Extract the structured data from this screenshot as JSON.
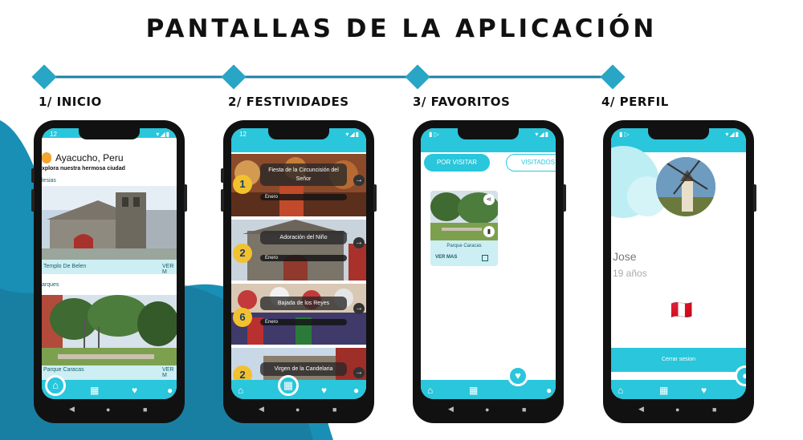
{
  "title": "PANTALLAS DE LA APLICACIÓN",
  "steps": [
    "1/ INICIO",
    "2/ FESTIVIDADES",
    "3/ FAVORITOS",
    "4/ PERFIL"
  ],
  "colors": {
    "accent": "#29c6dc",
    "dark": "#111111",
    "wave": "#1a8fb5",
    "timeline": "#1e7ea1"
  },
  "inicio": {
    "city": "Ayacucho, Peru",
    "subtitle": "xplora nuestra hermosa ciudad",
    "section1": "lesias",
    "place1": "Templo De Belen",
    "section2": "arques",
    "place2": "Parque Caracas",
    "ver": "VER M"
  },
  "festividades": {
    "items": [
      {
        "num": "1",
        "name": "Fiesta de la Circuncisión del Señor",
        "month": "Enero"
      },
      {
        "num": "2",
        "name": "Adoración del Niño",
        "month": "Enero"
      },
      {
        "num": "6",
        "name": "Bajada de los Reyes",
        "month": "Enero"
      },
      {
        "num": "2",
        "name": "Virgen de la Candelaria",
        "month": ""
      }
    ]
  },
  "favoritos": {
    "tab1": "POR VISITAR",
    "tab2": "VISITADOS",
    "place": "Parque Caracas",
    "ver_mas": "VER MAS"
  },
  "perfil": {
    "name": "Jose",
    "age": "19 años",
    "flag": "🇵🇪",
    "logout": "Cerrar sesion"
  }
}
